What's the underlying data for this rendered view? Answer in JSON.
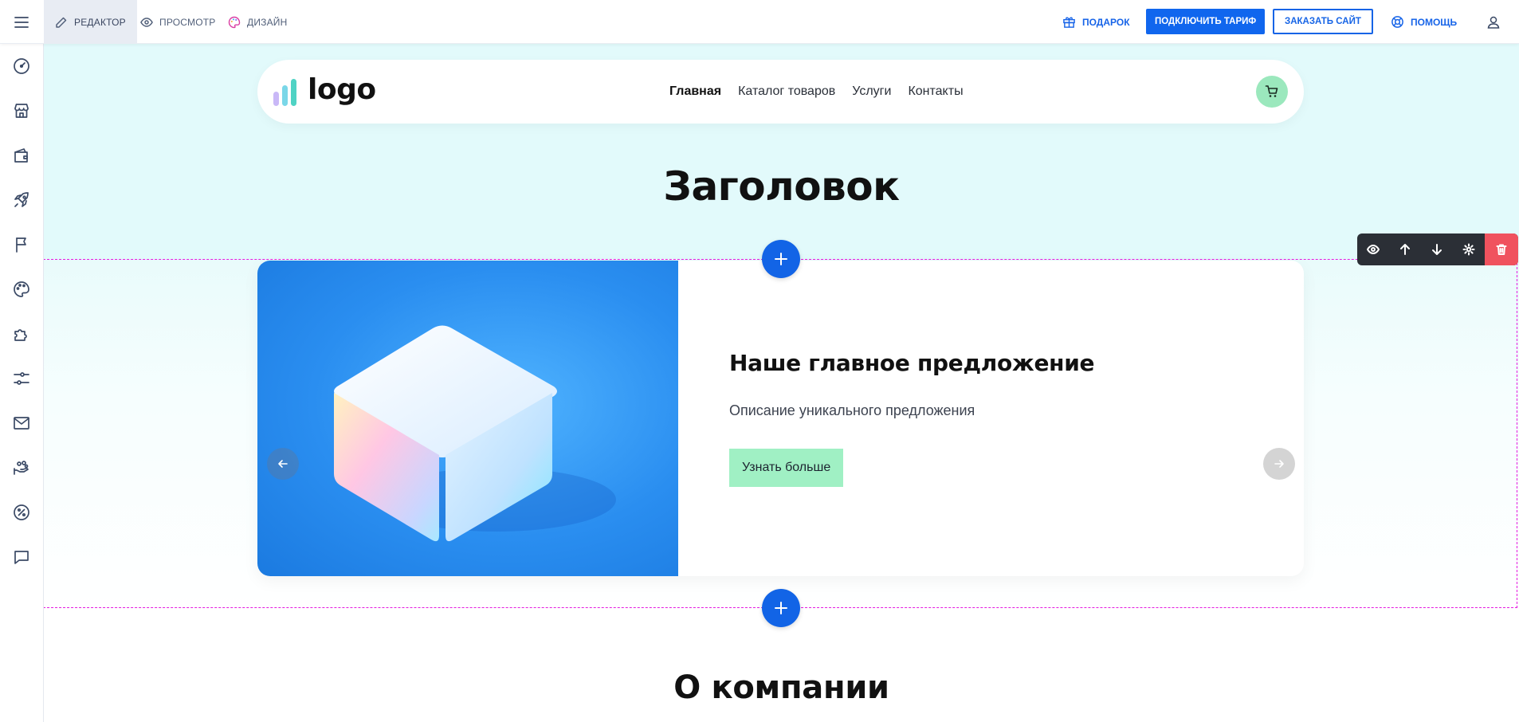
{
  "topbar": {
    "tabs": [
      {
        "label": "РЕДАКТОР",
        "icon": "pencil-icon",
        "active": true
      },
      {
        "label": "ПРОСМОТР",
        "icon": "eye-icon",
        "active": false
      },
      {
        "label": "ДИЗАЙН",
        "icon": "palette-icon",
        "active": false
      }
    ],
    "gift_label": "ПОДАРОК",
    "tariff_label": "ПОДКЛЮЧИТЬ ТАРИФ",
    "order_site_label": "ЗАКАЗАТЬ САЙТ",
    "help_label": "ПОМОЩЬ"
  },
  "sidebar": {
    "icons": [
      "dashboard-icon",
      "store-icon",
      "wallet-icon",
      "rocket-icon",
      "flag-icon",
      "palette-icon",
      "puzzle-icon",
      "sliders-icon",
      "mail-icon",
      "loyalty-icon",
      "percent-icon",
      "chat-icon"
    ]
  },
  "site": {
    "logo_text": "logo",
    "nav": [
      "Главная",
      "Каталог товаров",
      "Услуги",
      "Контакты"
    ],
    "hero_title": "Заголовок",
    "slide": {
      "title": "Наше главное предложение",
      "description": "Описание уникального предложения",
      "cta": "Узнать больше"
    },
    "about_title": "О компании"
  },
  "colors": {
    "primary": "#1066ee",
    "hero_bg": "#e2fafb",
    "cta_bg": "#a0f0c4",
    "cart_bg": "#9be8bd",
    "selection_border": "#e51be1",
    "delete": "#f0525e"
  }
}
